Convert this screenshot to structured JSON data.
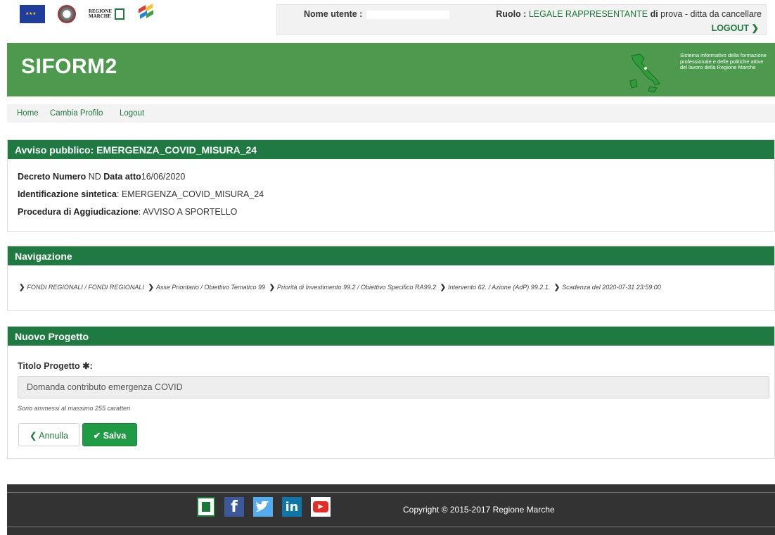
{
  "user": {
    "name_label": "Nome utente :",
    "role_label": "Ruolo :",
    "role_value": "LEGALE RAPPRESENTANTE",
    "company_prefix": "di",
    "company_name": "prova - ditta da cancellare",
    "logout_label": "LOGOUT ❯"
  },
  "header": {
    "brand": "SIFORM2",
    "description": "Sistema informativo della formazione professionale e delle politiche attive del lavoro della Regione Marche"
  },
  "logos": {
    "marche_line1": "REGIONE",
    "marche_line2": "MARCHE"
  },
  "nav": {
    "home": "Home",
    "cambia_profilo": "Cambia Profilo",
    "logout": "Logout"
  },
  "avviso": {
    "title": "Avviso pubblico: EMERGENZA_COVID_MISURA_24",
    "decreto_label": "Decreto Numero",
    "decreto_value": "ND",
    "data_label": "Data atto",
    "data_value": "16/06/2020",
    "ident_label": "Identificazione sintetica",
    "ident_value": ": EMERGENZA_COVID_MISURA_24",
    "proc_label": "Procedura di Aggiudicazione",
    "proc_value": ": AVVISO A SPORTELLO"
  },
  "navigazione": {
    "title": "Navigazione",
    "crumbs": [
      "FONDI REGIONALI / FONDI REGIONALI",
      "Asse Prioritario / Obiettivo Tematico 99",
      "Priorità di Investimento 99.2 / Obiettivo Specifico RA99.2",
      "Intervento 62. / Azione (AdP) 99.2.1.",
      "Scadenza del 2020-07-31 23:59:00"
    ],
    "separator": "❯"
  },
  "progetto": {
    "title": "Nuovo Progetto",
    "field_label": "Titolo Progetto",
    "required_mark": "✱:",
    "field_value": "Domanda contributo emergenza COVID",
    "hint": "Sono ammessi al massimo 255 caratteri",
    "cancel_label": "❮ Annulla",
    "save_label": "✔ Salva"
  },
  "footer": {
    "copyright": "Copyright © 2015-2017 Regione Marche",
    "icons": [
      "regione-marche-icon",
      "facebook-icon",
      "twitter-icon",
      "linkedin-icon",
      "youtube-icon"
    ],
    "fb": "f",
    "tw": "🐦",
    "in": "in",
    "yt": "▶"
  },
  "colors": {
    "brand_green": "#4d9a4f",
    "panel_header": "#1f7a41",
    "save_button": "#1f9a45",
    "link_green": "#1e7a3c",
    "footer": "#333333"
  }
}
